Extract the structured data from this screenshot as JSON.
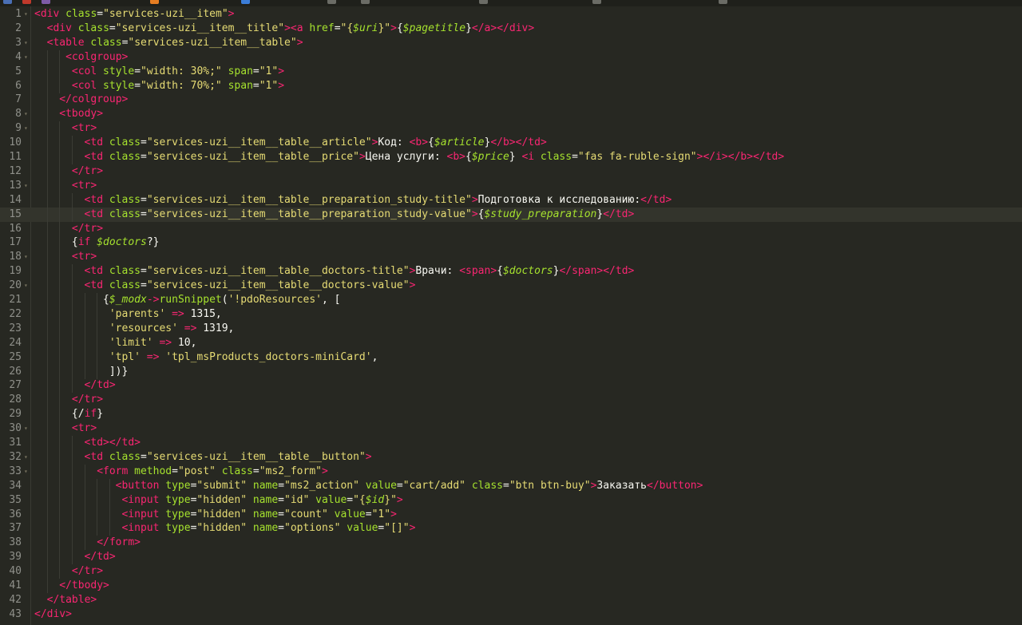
{
  "editor": {
    "active_line": 15,
    "lines": [
      {
        "n": "1",
        "indent": 0,
        "fold": true,
        "tokens": [
          [
            "t",
            "<div"
          ],
          [
            "a",
            " class"
          ],
          [
            "p",
            "="
          ],
          [
            "s",
            "\"services-uzi__item\""
          ],
          [
            "t",
            ">"
          ]
        ]
      },
      {
        "n": "2",
        "indent": 2,
        "fold": false,
        "tokens": [
          [
            "t",
            "<div"
          ],
          [
            "a",
            " class"
          ],
          [
            "p",
            "="
          ],
          [
            "s",
            "\"services-uzi__item__title\""
          ],
          [
            "t",
            ">"
          ],
          [
            "t",
            "<a"
          ],
          [
            "a",
            " href"
          ],
          [
            "p",
            "="
          ],
          [
            "s",
            "\"{"
          ],
          [
            "v",
            "$uri"
          ],
          [
            "s",
            "}\""
          ],
          [
            "t",
            ">"
          ],
          [
            "p",
            "{"
          ],
          [
            "v",
            "$pagetitle"
          ],
          [
            "p",
            "}"
          ],
          [
            "t",
            "</a>"
          ],
          [
            "t",
            "</div>"
          ]
        ]
      },
      {
        "n": "3",
        "indent": 2,
        "fold": true,
        "tokens": [
          [
            "t",
            "<table"
          ],
          [
            "a",
            " class"
          ],
          [
            "p",
            "="
          ],
          [
            "s",
            "\"services-uzi__item__table\""
          ],
          [
            "t",
            ">"
          ]
        ]
      },
      {
        "n": "4",
        "indent": 5,
        "fold": true,
        "tokens": [
          [
            "t",
            "<colgroup>"
          ]
        ]
      },
      {
        "n": "5",
        "indent": 6,
        "fold": false,
        "tokens": [
          [
            "t",
            "<col"
          ],
          [
            "a",
            " style"
          ],
          [
            "p",
            "="
          ],
          [
            "s",
            "\"width: 30%;\""
          ],
          [
            "a",
            " span"
          ],
          [
            "p",
            "="
          ],
          [
            "s",
            "\"1\""
          ],
          [
            "t",
            ">"
          ]
        ]
      },
      {
        "n": "6",
        "indent": 6,
        "fold": false,
        "tokens": [
          [
            "t",
            "<col"
          ],
          [
            "a",
            " style"
          ],
          [
            "p",
            "="
          ],
          [
            "s",
            "\"width: 70%;\""
          ],
          [
            "a",
            " span"
          ],
          [
            "p",
            "="
          ],
          [
            "s",
            "\"1\""
          ],
          [
            "t",
            ">"
          ]
        ]
      },
      {
        "n": "7",
        "indent": 4,
        "fold": false,
        "tokens": [
          [
            "t",
            "</colgroup>"
          ]
        ]
      },
      {
        "n": "8",
        "indent": 4,
        "fold": true,
        "tokens": [
          [
            "t",
            "<tbody>"
          ]
        ]
      },
      {
        "n": "9",
        "indent": 6,
        "fold": true,
        "tokens": [
          [
            "t",
            "<tr>"
          ]
        ]
      },
      {
        "n": "10",
        "indent": 8,
        "fold": false,
        "tokens": [
          [
            "t",
            "<td"
          ],
          [
            "a",
            " class"
          ],
          [
            "p",
            "="
          ],
          [
            "s",
            "\"services-uzi__item__table__article\""
          ],
          [
            "t",
            ">"
          ],
          [
            "p",
            "Код: "
          ],
          [
            "t",
            "<b>"
          ],
          [
            "p",
            "{"
          ],
          [
            "v",
            "$article"
          ],
          [
            "p",
            "}"
          ],
          [
            "t",
            "</b>"
          ],
          [
            "t",
            "</td>"
          ]
        ]
      },
      {
        "n": "11",
        "indent": 8,
        "fold": false,
        "tokens": [
          [
            "t",
            "<td"
          ],
          [
            "a",
            " class"
          ],
          [
            "p",
            "="
          ],
          [
            "s",
            "\"services-uzi__item__table__price\""
          ],
          [
            "t",
            ">"
          ],
          [
            "p",
            "Цена услуги: "
          ],
          [
            "t",
            "<b>"
          ],
          [
            "p",
            "{"
          ],
          [
            "v",
            "$price"
          ],
          [
            "p",
            "} "
          ],
          [
            "t",
            "<i"
          ],
          [
            "a",
            " class"
          ],
          [
            "p",
            "="
          ],
          [
            "s",
            "\"fas fa-ruble-sign\""
          ],
          [
            "t",
            ">"
          ],
          [
            "t",
            "</i>"
          ],
          [
            "t",
            "</b>"
          ],
          [
            "t",
            "</td>"
          ]
        ]
      },
      {
        "n": "12",
        "indent": 6,
        "fold": false,
        "tokens": [
          [
            "t",
            "</tr>"
          ]
        ]
      },
      {
        "n": "13",
        "indent": 6,
        "fold": true,
        "tokens": [
          [
            "t",
            "<tr>"
          ]
        ]
      },
      {
        "n": "14",
        "indent": 8,
        "fold": false,
        "tokens": [
          [
            "t",
            "<td"
          ],
          [
            "a",
            " class"
          ],
          [
            "p",
            "="
          ],
          [
            "s",
            "\"services-uzi__item__table__preparation_study-title\""
          ],
          [
            "t",
            ">"
          ],
          [
            "p",
            "Подготовка к исследованию:"
          ],
          [
            "t",
            "</td>"
          ]
        ]
      },
      {
        "n": "15",
        "indent": 8,
        "fold": false,
        "tokens": [
          [
            "t",
            "<td"
          ],
          [
            "a",
            " class"
          ],
          [
            "p",
            "="
          ],
          [
            "s",
            "\"services-uzi__item__table__preparation_study-value\""
          ],
          [
            "t",
            ">"
          ],
          [
            "p",
            "{"
          ],
          [
            "v",
            "$study_preparation"
          ],
          [
            "p",
            "}"
          ],
          [
            "t",
            "</td>"
          ]
        ]
      },
      {
        "n": "16",
        "indent": 6,
        "fold": false,
        "tokens": [
          [
            "t",
            "</tr>"
          ]
        ]
      },
      {
        "n": "17",
        "indent": 6,
        "fold": false,
        "tokens": [
          [
            "p",
            "{"
          ],
          [
            "t",
            "if"
          ],
          [
            "p",
            " "
          ],
          [
            "v",
            "$doctors"
          ],
          [
            "p",
            "?}"
          ]
        ]
      },
      {
        "n": "18",
        "indent": 6,
        "fold": true,
        "tokens": [
          [
            "t",
            "<tr>"
          ]
        ]
      },
      {
        "n": "19",
        "indent": 8,
        "fold": false,
        "tokens": [
          [
            "t",
            "<td"
          ],
          [
            "a",
            " class"
          ],
          [
            "p",
            "="
          ],
          [
            "s",
            "\"services-uzi__item__table__doctors-title\""
          ],
          [
            "t",
            ">"
          ],
          [
            "p",
            "Врачи: "
          ],
          [
            "t",
            "<span>"
          ],
          [
            "p",
            "{"
          ],
          [
            "v",
            "$doctors"
          ],
          [
            "p",
            "}"
          ],
          [
            "t",
            "</span>"
          ],
          [
            "t",
            "</td>"
          ]
        ]
      },
      {
        "n": "20",
        "indent": 8,
        "fold": true,
        "tokens": [
          [
            "t",
            "<td"
          ],
          [
            "a",
            " class"
          ],
          [
            "p",
            "="
          ],
          [
            "s",
            "\"services-uzi__item__table__doctors-value\""
          ],
          [
            "t",
            ">"
          ]
        ]
      },
      {
        "n": "21",
        "indent": 11,
        "fold": false,
        "tokens": [
          [
            "p",
            "{"
          ],
          [
            "v",
            "$_modx"
          ],
          [
            "t",
            "->"
          ],
          [
            "a",
            "runSnippet"
          ],
          [
            "p",
            "("
          ],
          [
            "s",
            "'!pdoResources'"
          ],
          [
            "p",
            ", ["
          ]
        ]
      },
      {
        "n": "22",
        "indent": 12,
        "fold": false,
        "tokens": [
          [
            "s",
            "'parents'"
          ],
          [
            "p",
            " "
          ],
          [
            "t",
            "=>"
          ],
          [
            "p",
            " 1315,"
          ]
        ]
      },
      {
        "n": "23",
        "indent": 12,
        "fold": false,
        "tokens": [
          [
            "s",
            "'resources'"
          ],
          [
            "p",
            " "
          ],
          [
            "t",
            "=>"
          ],
          [
            "p",
            " 1319,"
          ]
        ]
      },
      {
        "n": "24",
        "indent": 12,
        "fold": false,
        "tokens": [
          [
            "s",
            "'limit'"
          ],
          [
            "p",
            " "
          ],
          [
            "t",
            "=>"
          ],
          [
            "p",
            " 10,"
          ]
        ]
      },
      {
        "n": "25",
        "indent": 12,
        "fold": false,
        "tokens": [
          [
            "s",
            "'tpl'"
          ],
          [
            "p",
            " "
          ],
          [
            "t",
            "=>"
          ],
          [
            "p",
            " "
          ],
          [
            "s",
            "'tpl_msProducts_doctors-miniCard'"
          ],
          [
            "p",
            ","
          ]
        ]
      },
      {
        "n": "26",
        "indent": 12,
        "fold": false,
        "tokens": [
          [
            "p",
            "])}"
          ]
        ]
      },
      {
        "n": "27",
        "indent": 8,
        "fold": false,
        "tokens": [
          [
            "t",
            "</td>"
          ]
        ]
      },
      {
        "n": "28",
        "indent": 6,
        "fold": false,
        "tokens": [
          [
            "t",
            "</tr>"
          ]
        ]
      },
      {
        "n": "29",
        "indent": 6,
        "fold": false,
        "tokens": [
          [
            "p",
            "{/"
          ],
          [
            "t",
            "if"
          ],
          [
            "p",
            "}"
          ]
        ]
      },
      {
        "n": "30",
        "indent": 6,
        "fold": true,
        "tokens": [
          [
            "t",
            "<tr>"
          ]
        ]
      },
      {
        "n": "31",
        "indent": 8,
        "fold": false,
        "tokens": [
          [
            "t",
            "<td>"
          ],
          [
            "t",
            "</td>"
          ]
        ]
      },
      {
        "n": "32",
        "indent": 8,
        "fold": true,
        "tokens": [
          [
            "t",
            "<td"
          ],
          [
            "a",
            " class"
          ],
          [
            "p",
            "="
          ],
          [
            "s",
            "\"services-uzi__item__table__button\""
          ],
          [
            "t",
            ">"
          ]
        ]
      },
      {
        "n": "33",
        "indent": 10,
        "fold": true,
        "tokens": [
          [
            "t",
            "<form"
          ],
          [
            "a",
            " method"
          ],
          [
            "p",
            "="
          ],
          [
            "s",
            "\"post\""
          ],
          [
            "a",
            " class"
          ],
          [
            "p",
            "="
          ],
          [
            "s",
            "\"ms2_form\""
          ],
          [
            "t",
            ">"
          ]
        ]
      },
      {
        "n": "34",
        "indent": 13,
        "fold": false,
        "tokens": [
          [
            "t",
            "<button"
          ],
          [
            "a",
            " type"
          ],
          [
            "p",
            "="
          ],
          [
            "s",
            "\"submit\""
          ],
          [
            "a",
            " name"
          ],
          [
            "p",
            "="
          ],
          [
            "s",
            "\"ms2_action\""
          ],
          [
            "a",
            " value"
          ],
          [
            "p",
            "="
          ],
          [
            "s",
            "\"cart/add\""
          ],
          [
            "a",
            " class"
          ],
          [
            "p",
            "="
          ],
          [
            "s",
            "\"btn btn-buy\""
          ],
          [
            "t",
            ">"
          ],
          [
            "p",
            "Заказать"
          ],
          [
            "t",
            "</button>"
          ]
        ]
      },
      {
        "n": "35",
        "indent": 14,
        "fold": false,
        "tokens": [
          [
            "t",
            "<input"
          ],
          [
            "a",
            " type"
          ],
          [
            "p",
            "="
          ],
          [
            "s",
            "\"hidden\""
          ],
          [
            "a",
            " name"
          ],
          [
            "p",
            "="
          ],
          [
            "s",
            "\"id\""
          ],
          [
            "a",
            " value"
          ],
          [
            "p",
            "="
          ],
          [
            "s",
            "\"{"
          ],
          [
            "v",
            "$id"
          ],
          [
            "s",
            "}\""
          ],
          [
            "t",
            ">"
          ]
        ]
      },
      {
        "n": "36",
        "indent": 14,
        "fold": false,
        "tokens": [
          [
            "t",
            "<input"
          ],
          [
            "a",
            " type"
          ],
          [
            "p",
            "="
          ],
          [
            "s",
            "\"hidden\""
          ],
          [
            "a",
            " name"
          ],
          [
            "p",
            "="
          ],
          [
            "s",
            "\"count\""
          ],
          [
            "a",
            " value"
          ],
          [
            "p",
            "="
          ],
          [
            "s",
            "\"1\""
          ],
          [
            "t",
            ">"
          ]
        ]
      },
      {
        "n": "37",
        "indent": 14,
        "fold": false,
        "tokens": [
          [
            "t",
            "<input"
          ],
          [
            "a",
            " type"
          ],
          [
            "p",
            "="
          ],
          [
            "s",
            "\"hidden\""
          ],
          [
            "a",
            " name"
          ],
          [
            "p",
            "="
          ],
          [
            "s",
            "\"options\""
          ],
          [
            "a",
            " value"
          ],
          [
            "p",
            "="
          ],
          [
            "s",
            "\"[]\""
          ],
          [
            "t",
            ">"
          ]
        ]
      },
      {
        "n": "38",
        "indent": 10,
        "fold": false,
        "tokens": [
          [
            "t",
            "</form>"
          ]
        ]
      },
      {
        "n": "39",
        "indent": 8,
        "fold": false,
        "tokens": [
          [
            "t",
            "</td>"
          ]
        ]
      },
      {
        "n": "40",
        "indent": 6,
        "fold": false,
        "tokens": [
          [
            "t",
            "</tr>"
          ]
        ]
      },
      {
        "n": "41",
        "indent": 4,
        "fold": false,
        "tokens": [
          [
            "t",
            "</tbody>"
          ]
        ]
      },
      {
        "n": "42",
        "indent": 2,
        "fold": false,
        "tokens": [
          [
            "t",
            "</table>"
          ]
        ]
      },
      {
        "n": "43",
        "indent": 0,
        "fold": false,
        "tokens": [
          [
            "t",
            "</div>"
          ]
        ]
      }
    ]
  },
  "colors": {
    "background": "#272822",
    "tag": "#f92672",
    "attribute": "#a6e22e",
    "string": "#e6db74",
    "variable": "#a6e22e",
    "plain": "#f8f8f2",
    "line_number": "#8f908a"
  }
}
